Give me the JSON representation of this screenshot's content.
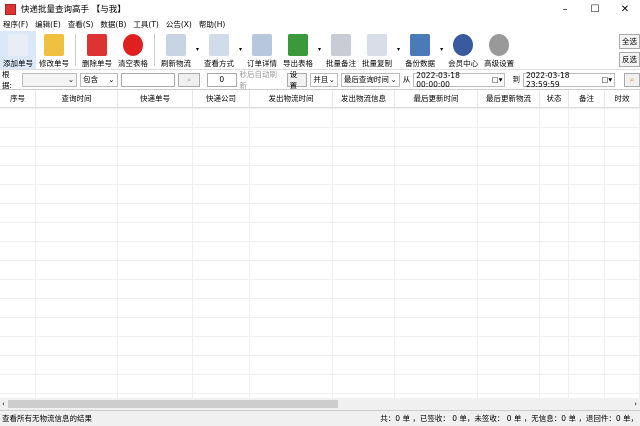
{
  "window": {
    "title": "快递批量查询高手 【与我】",
    "minimize": "–",
    "maximize": "☐",
    "close": "✕"
  },
  "menu": [
    "程序(F)",
    "编辑(E)",
    "查看(S)",
    "数据(B)",
    "工具(T)",
    "公告(X)",
    "帮助(H)"
  ],
  "toolbar": [
    {
      "label": "添加单号",
      "icon": "document-icon",
      "color": "#e8eef6"
    },
    {
      "label": "修改单号",
      "icon": "pencil-icon",
      "color": "#f0c040"
    },
    {
      "label": "删除单号",
      "icon": "delete-doc-icon",
      "color": "#d33"
    },
    {
      "label": "清空表格",
      "icon": "clear-icon",
      "color": "#e02020"
    },
    {
      "label": "刷新物流",
      "icon": "refresh-doc-icon",
      "color": "#c8d4e4"
    },
    {
      "label": "查看方式",
      "icon": "checklist-icon",
      "color": "#d0dcea"
    },
    {
      "label": "订单详情",
      "icon": "details-icon",
      "color": "#b8c8dc"
    },
    {
      "label": "导出表格",
      "icon": "export-icon",
      "color": "#3a9a3a"
    },
    {
      "label": "批量备注",
      "icon": "scroll-icon",
      "color": "#c8ccd4"
    },
    {
      "label": "批量复制",
      "icon": "copy-icon",
      "color": "#d8dee8"
    },
    {
      "label": "备份数据",
      "icon": "floppy-icon",
      "color": "#4a7ab8"
    },
    {
      "label": "会员中心",
      "icon": "globe-icon",
      "color": "#3a5aa0"
    },
    {
      "label": "高级设置",
      "icon": "gear-icon",
      "color": "#999"
    }
  ],
  "side_buttons": {
    "select_all": "全选",
    "invert": "反选"
  },
  "filter": {
    "by_label": "根据:",
    "field_value": "",
    "match_value": "包含",
    "search_value": "",
    "seconds_value": "0",
    "auto_refresh_label": "秒后自动刷新",
    "settings": "设置",
    "logic": "并且",
    "time_field": "最后查询时间",
    "from_label": "从",
    "from_date": "2022-03-18 00:00:00",
    "to_label": "到",
    "to_date": "2022-03-18 23:59:59"
  },
  "columns": [
    "序号",
    "查询时间",
    "快递单号",
    "快递公司",
    "发出物流时间",
    "发出物流信息",
    "最后更新时间",
    "最后更新物流",
    "状态",
    "备注",
    "时效"
  ],
  "status": {
    "left": "查看所有无物流信息的结果",
    "right": "共：0 单 ，已签收： 0 单，未签收： 0 单 ，无信息：0 单 ，退回件：0 单，"
  }
}
